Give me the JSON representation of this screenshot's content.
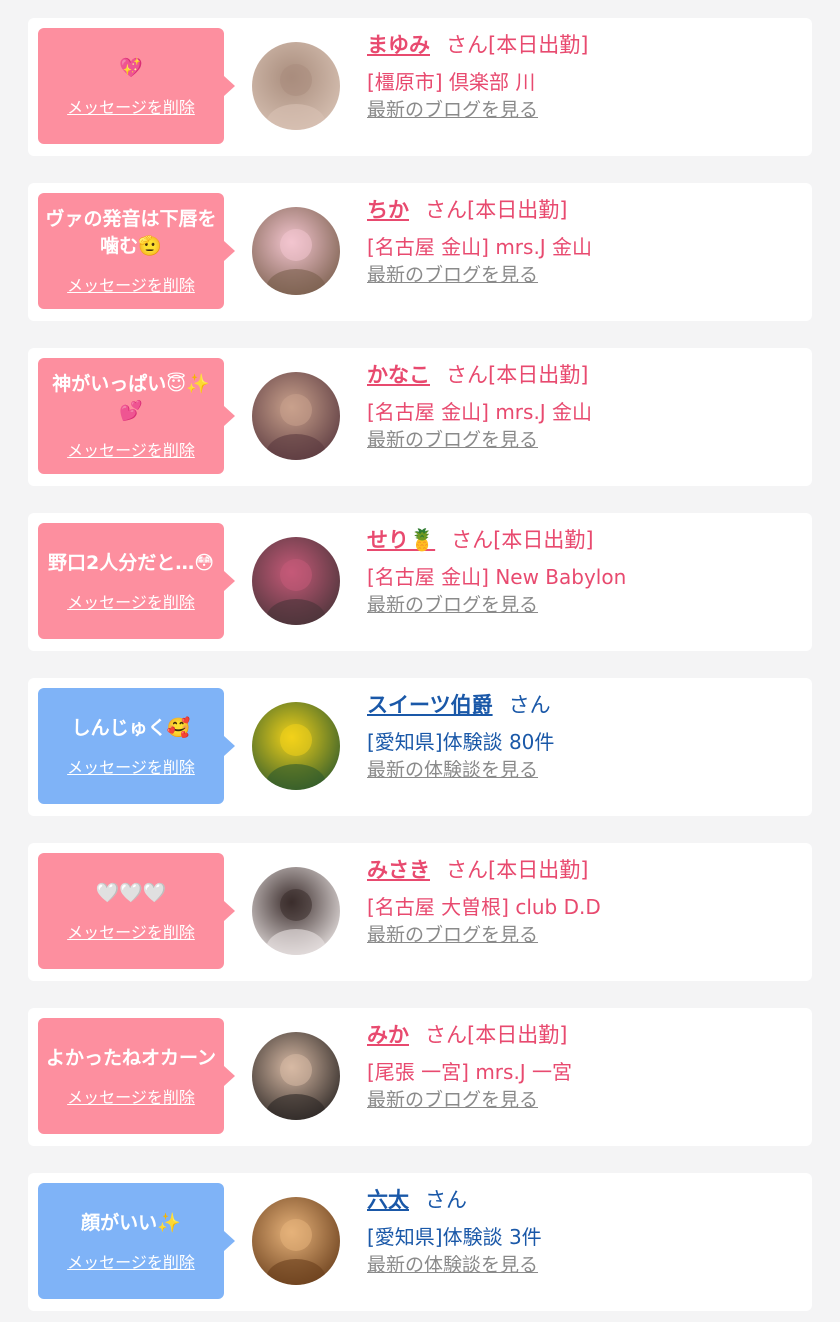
{
  "cards": [
    {
      "type": "cast",
      "message": "💖",
      "delete_label": "メッセージを削除",
      "name": "まゆみ",
      "suffix": "さん[本日出勤]",
      "shop": "[橿原市] 倶楽部 川",
      "link": "最新のブログを見る",
      "avatar_colors": [
        "#d8c2b4",
        "#a98d7d"
      ]
    },
    {
      "type": "cast",
      "message": "ヴァの発音は下唇を噛む🫡",
      "delete_label": "メッセージを削除",
      "name": "ちか",
      "suffix": "さん[本日出勤]",
      "shop": "[名古屋 金山] mrs.J 金山",
      "link": "最新のブログを見る",
      "avatar_colors": [
        "#7a5f4d",
        "#f3c5cf"
      ]
    },
    {
      "type": "cast",
      "message": "神がいっぱい😇✨💕",
      "delete_label": "メッセージを削除",
      "name": "かなこ",
      "suffix": "さん[本日出勤]",
      "shop": "[名古屋 金山] mrs.J 金山",
      "link": "最新のブログを見る",
      "avatar_colors": [
        "#5b3a40",
        "#c9a18c"
      ]
    },
    {
      "type": "cast",
      "message": "野口2人分だと…😳",
      "delete_label": "メッセージを削除",
      "name": "せり🍍",
      "suffix": "さん[本日出勤]",
      "shop": "[名古屋 金山] New Babylon",
      "link": "最新のブログを見る",
      "avatar_colors": [
        "#4a3439",
        "#c55a78"
      ]
    },
    {
      "type": "user",
      "message": "しんじゅく🥰",
      "delete_label": "メッセージを削除",
      "name": "スイーツ伯爵",
      "suffix": "さん",
      "shop": "[愛知県]体験談 80件",
      "link": "最新の体験談を見る",
      "avatar_colors": [
        "#2f5a2b",
        "#f2d21a"
      ]
    },
    {
      "type": "cast",
      "message": "🤍🤍🤍",
      "delete_label": "メッセージを削除",
      "name": "みさき",
      "suffix": "さん[本日出勤]",
      "shop": "[名古屋 大曽根] club D.D",
      "link": "最新のブログを見る",
      "avatar_colors": [
        "#e9e3e2",
        "#3b2d2c"
      ]
    },
    {
      "type": "cast",
      "message": "よかったねオカーン",
      "delete_label": "メッセージを削除",
      "name": "みか",
      "suffix": "さん[本日出勤]",
      "shop": "[尾張 一宮] mrs.J 一宮",
      "link": "最新のブログを見る",
      "avatar_colors": [
        "#2b2624",
        "#d7b9a4"
      ]
    },
    {
      "type": "user",
      "message": "顔がいい✨",
      "delete_label": "メッセージを削除",
      "name": "六太",
      "suffix": "さん",
      "shop": "[愛知県]体験談 3件",
      "link": "最新の体験談を見る",
      "avatar_colors": [
        "#6a3f1c",
        "#e6b27a"
      ]
    }
  ],
  "colors": {
    "cast_bubble": "#fd8f9f",
    "user_bubble": "#7fb3f7",
    "cast_text": "#e84a6f",
    "user_text": "#1a58a8",
    "link_text": "#8a8a8a"
  }
}
